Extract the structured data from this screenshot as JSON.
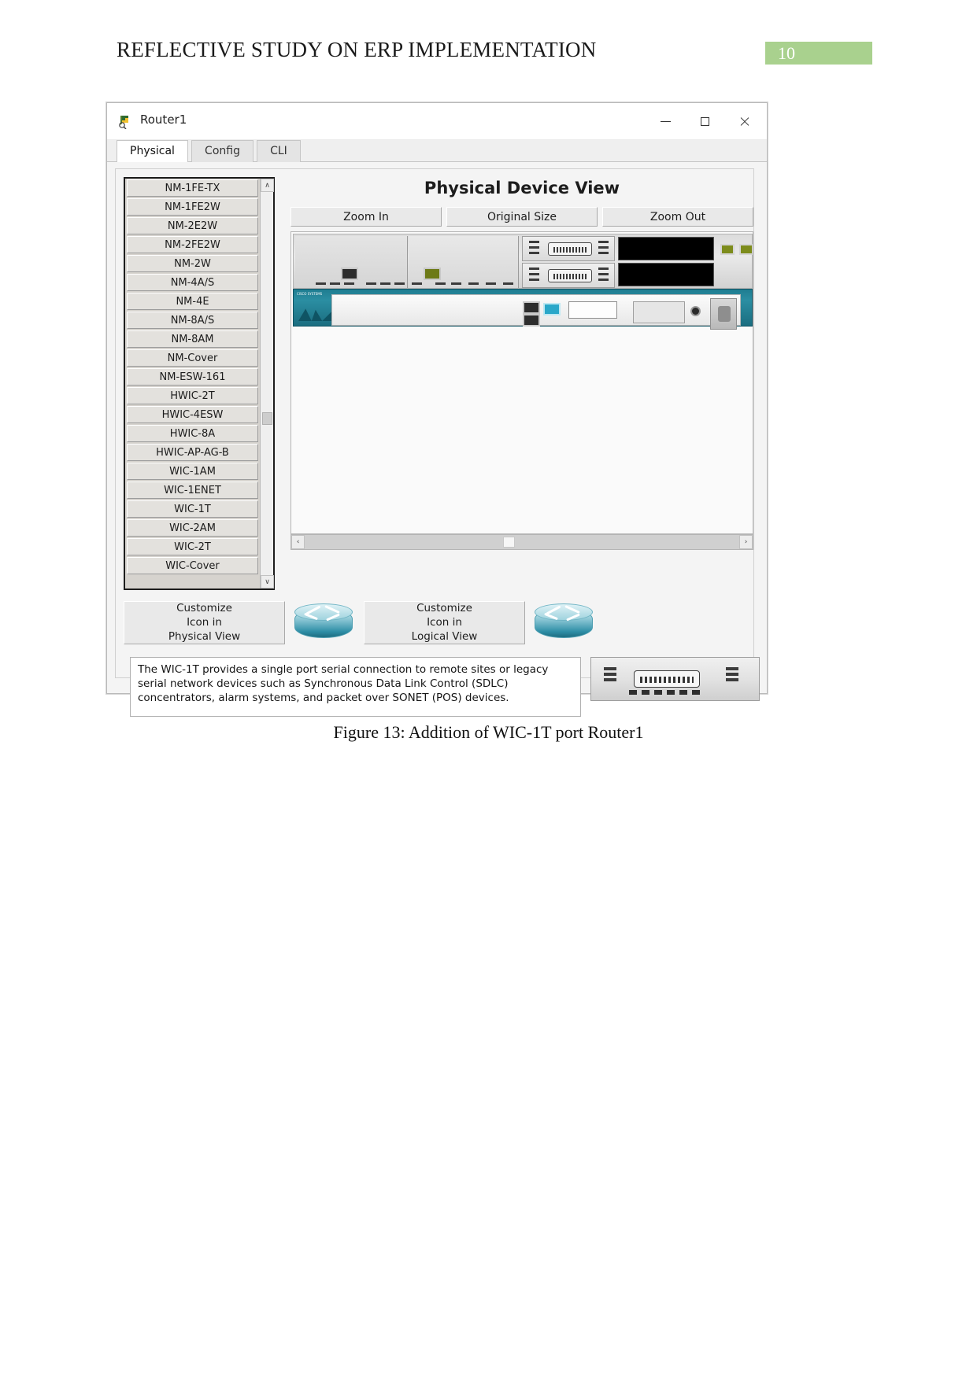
{
  "document": {
    "header_title": "REFLECTIVE STUDY ON ERP IMPLEMENTATION",
    "page_number": "10",
    "page_badge_color": "#a9d18e",
    "figure_caption": "Figure 13: Addition of WIC-1T port Router1"
  },
  "window": {
    "title": "Router1",
    "icon": "router-device-icon",
    "controls": {
      "minimize": "minimize-icon",
      "maximize": "maximize-icon",
      "close": "close-icon"
    },
    "tabs": [
      {
        "label": "Physical",
        "active": true
      },
      {
        "label": "Config",
        "active": false
      },
      {
        "label": "CLI",
        "active": false
      }
    ]
  },
  "modules": {
    "scroll_up_glyph": "∧",
    "scroll_down_glyph": "∨",
    "items": [
      {
        "label": "NM-1FE-TX"
      },
      {
        "label": "NM-1FE2W"
      },
      {
        "label": "NM-2E2W"
      },
      {
        "label": "NM-2FE2W"
      },
      {
        "label": "NM-2W"
      },
      {
        "label": "NM-4A/S"
      },
      {
        "label": "NM-4E"
      },
      {
        "label": "NM-8A/S"
      },
      {
        "label": "NM-8AM"
      },
      {
        "label": "NM-Cover"
      },
      {
        "label": "NM-ESW-161"
      },
      {
        "label": "HWIC-2T"
      },
      {
        "label": "HWIC-4ESW"
      },
      {
        "label": "HWIC-8A"
      },
      {
        "label": "HWIC-AP-AG-B"
      },
      {
        "label": "WIC-1AM"
      },
      {
        "label": "WIC-1ENET"
      },
      {
        "label": "WIC-1T"
      },
      {
        "label": "WIC-2AM"
      },
      {
        "label": "WIC-2T"
      },
      {
        "label": "WIC-Cover"
      }
    ]
  },
  "device_view": {
    "title": "Physical Device View",
    "zoom_in": "Zoom In",
    "original_size": "Original Size",
    "zoom_out": "Zoom Out",
    "hscroll_left_glyph": "‹",
    "hscroll_right_glyph": "›"
  },
  "customize": {
    "physical": {
      "line1": "Customize",
      "line2": "Icon in",
      "line3": "Physical View"
    },
    "logical": {
      "line1": "Customize",
      "line2": "Icon in",
      "line3": "Logical View"
    }
  },
  "description": {
    "text": "The WIC-1T provides a single port serial connection to remote sites or legacy serial network devices such as Synchronous Data Link Control (SDLC) concentrators, alarm systems, and packet over SONET (POS) devices."
  }
}
